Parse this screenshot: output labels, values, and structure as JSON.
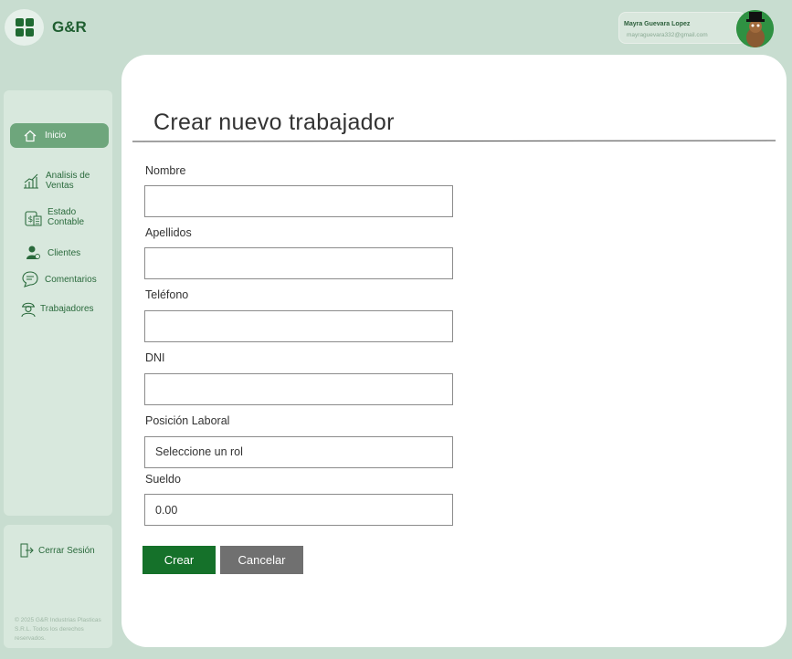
{
  "header": {
    "brand": "G&R",
    "user": {
      "name": "Mayra Guevara Lopez",
      "email": "mayraguevara332@gmail.com"
    },
    "icons": {
      "logo": "grid-logo-icon",
      "avatar": "avatar-icon"
    }
  },
  "sidebar": {
    "items": [
      {
        "label": "Inicio",
        "icon": "home-icon",
        "active": true
      },
      {
        "label": "Analisis de Ventas",
        "icon": "chart-icon",
        "active": false
      },
      {
        "label": "Estado Contable",
        "icon": "accounting-icon",
        "active": false
      },
      {
        "label": "Clientes",
        "icon": "user-icon",
        "active": false
      },
      {
        "label": "Comentarios",
        "icon": "chat-icon",
        "active": false
      },
      {
        "label": "Trabajadores",
        "icon": "worker-icon",
        "active": false
      }
    ],
    "logout_label": "Cerrar Sesión",
    "copyright": "© 2025 G&R Industrias Plasticas S.R.L. Todos los derechos reservados."
  },
  "form": {
    "title": "Crear nuevo trabajador",
    "fields": {
      "nombre": {
        "label": "Nombre",
        "value": ""
      },
      "apellidos": {
        "label": "Apellidos",
        "value": ""
      },
      "telefono": {
        "label": "Teléfono",
        "value": ""
      },
      "dni": {
        "label": "DNI",
        "value": ""
      },
      "posicion": {
        "label": "Posición Laboral",
        "value": "Seleccione un rol"
      },
      "sueldo": {
        "label": "Sueldo",
        "value": "0.00"
      }
    },
    "create_label": "Crear",
    "cancel_label": "Cancelar"
  },
  "colors": {
    "background": "#c8ddd0",
    "brand_green": "#1f5e30",
    "active_nav": "#6ea67c",
    "create_button": "#15712a",
    "cancel_button": "#707070"
  }
}
